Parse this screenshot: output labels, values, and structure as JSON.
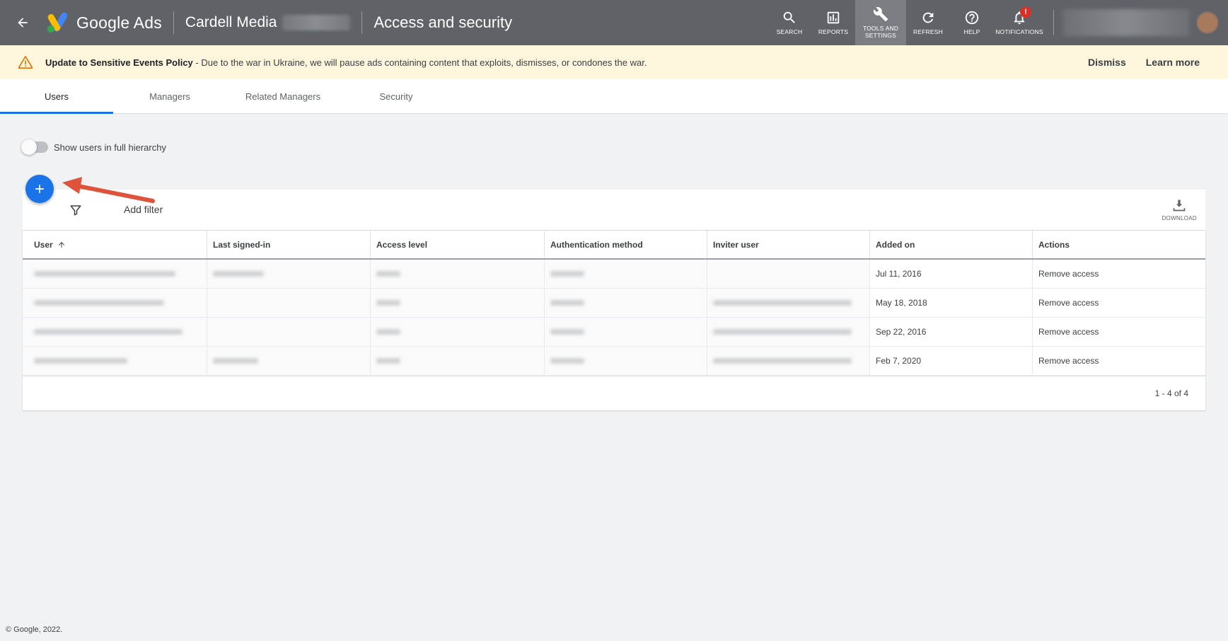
{
  "app": {
    "name": "Google Ads",
    "account": "Cardell Media",
    "page_title": "Access and security"
  },
  "toolbar": {
    "search": "SEARCH",
    "reports": "REPORTS",
    "tools_line1": "TOOLS AND",
    "tools_line2": "SETTINGS",
    "refresh": "REFRESH",
    "help": "HELP",
    "notifications": "NOTIFICATIONS",
    "notif_badge": "!"
  },
  "banner": {
    "title": "Update to Sensitive Events Policy",
    "message": " - Due to the war in Ukraine, we will pause ads containing content that exploits, dismisses, or condones the war.",
    "dismiss": "Dismiss",
    "learn_more": "Learn more"
  },
  "tabs": [
    {
      "label": "Users"
    },
    {
      "label": "Managers"
    },
    {
      "label": "Related Managers"
    },
    {
      "label": "Security"
    }
  ],
  "toggle": {
    "label": "Show users in full hierarchy",
    "on": false
  },
  "filter": {
    "add_filter": "Add filter",
    "download": "DOWNLOAD"
  },
  "table": {
    "columns": [
      "User",
      "Last signed-in",
      "Access level",
      "Authentication method",
      "Inviter user",
      "Added on",
      "Actions"
    ],
    "rows": [
      {
        "added_on": "Jul 11, 2016",
        "action": "Remove access"
      },
      {
        "added_on": "May 18, 2018",
        "action": "Remove access"
      },
      {
        "added_on": "Sep 22, 2016",
        "action": "Remove access"
      },
      {
        "added_on": "Feb 7, 2020",
        "action": "Remove access"
      }
    ],
    "pagination": "1 - 4 of 4"
  },
  "footer": {
    "copyright": "© Google, 2022."
  },
  "colors": {
    "topbar": "#5f6368",
    "accent": "#1a73e8",
    "banner": "#fdf6dd",
    "annotation_arrow": "#e0533b"
  }
}
